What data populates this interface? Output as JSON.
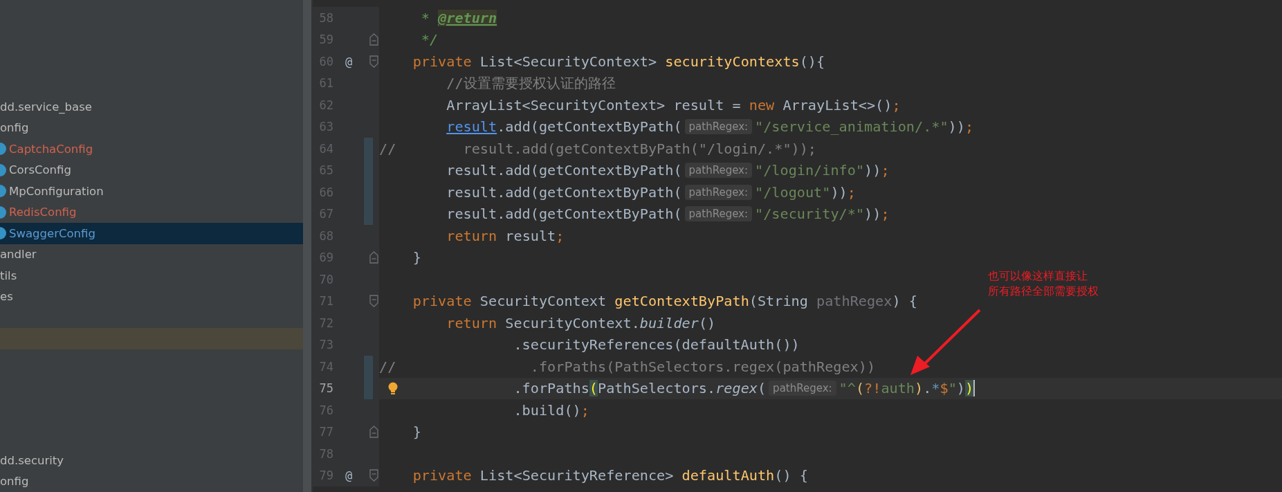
{
  "sidebar": {
    "sections": [
      {
        "items": [
          {
            "kind": "package",
            "label": "dd.service_base",
            "selected": false,
            "highlighted": false,
            "color": "#bbbbbb"
          },
          {
            "kind": "package",
            "label": "onfig",
            "selected": false,
            "highlighted": false,
            "color": "#bbbbbb"
          },
          {
            "kind": "class",
            "label": "CaptchaConfig",
            "selected": false,
            "highlighted": false,
            "color": "#d0624f"
          },
          {
            "kind": "class",
            "label": "CorsConfig",
            "selected": false,
            "highlighted": false,
            "color": "#bbbbbb"
          },
          {
            "kind": "class",
            "label": "MpConfiguration",
            "selected": false,
            "highlighted": false,
            "color": "#bbbbbb"
          },
          {
            "kind": "class",
            "label": "RedisConfig",
            "selected": false,
            "highlighted": false,
            "color": "#d0624f"
          },
          {
            "kind": "class",
            "label": "SwaggerConfig",
            "selected": true,
            "highlighted": false,
            "color": "#5a9bd3"
          },
          {
            "kind": "package",
            "label": "andler",
            "selected": false,
            "highlighted": false,
            "color": "#bbbbbb"
          },
          {
            "kind": "package",
            "label": "tils",
            "selected": false,
            "highlighted": false,
            "color": "#bbbbbb"
          },
          {
            "kind": "package",
            "label": "es",
            "selected": false,
            "highlighted": false,
            "color": "#bbbbbb"
          },
          {
            "kind": "blank",
            "selected": false,
            "highlighted": true
          }
        ]
      },
      {
        "items": [
          {
            "kind": "package",
            "label": "dd.security",
            "selected": false,
            "highlighted": false,
            "color": "#bbbbbb"
          },
          {
            "kind": "package",
            "label": "onfig",
            "selected": false,
            "highlighted": false,
            "color": "#bbbbbb"
          }
        ]
      }
    ]
  },
  "editor": {
    "lines": [
      {
        "number": "58",
        "tokens": [
          {
            "text": "     * ",
            "kind": "doc"
          },
          {
            "text": "@return",
            "kind": "doctag"
          }
        ]
      },
      {
        "number": "59",
        "fold_close": true,
        "tokens": [
          {
            "text": "     */",
            "kind": "doc"
          }
        ]
      },
      {
        "number": "60",
        "marker": "@",
        "fold_open": true,
        "tokens": [
          {
            "text": "    private",
            "kind": "keyword"
          },
          {
            "text": " List<SecurityContext> ",
            "kind": "plain"
          },
          {
            "text": "securityContexts",
            "kind": "method"
          },
          {
            "text": "(){",
            "kind": "plain"
          }
        ]
      },
      {
        "number": "61",
        "tokens": [
          {
            "text": "        //设置需要授权认证的路径",
            "kind": "comment"
          }
        ]
      },
      {
        "number": "62",
        "tokens": [
          {
            "text": "        ArrayList<SecurityContext> result = ",
            "kind": "plain"
          },
          {
            "text": "new",
            "kind": "keyword"
          },
          {
            "text": " ArrayList<>()",
            "kind": "plain"
          },
          {
            "text": ";",
            "kind": "keyword"
          }
        ]
      },
      {
        "number": "63",
        "tokens": [
          {
            "text": "        result",
            "kind": "link"
          },
          {
            "text": ".add(getContextByPath(",
            "kind": "plain"
          },
          {
            "text": "pathRegex:",
            "kind": "hint"
          },
          {
            "text": "\"/service_animation/.*\"",
            "kind": "string"
          },
          {
            "text": "))",
            "kind": "plain"
          },
          {
            "text": ";",
            "kind": "keyword"
          }
        ]
      },
      {
        "number": "64",
        "changed": true,
        "tokens": [
          {
            "text": "//        result.add(getContextByPath(\"/login/.*\"));",
            "kind": "comment"
          }
        ]
      },
      {
        "number": "65",
        "changed": true,
        "tokens": [
          {
            "text": "        result.add(getContextByPath(",
            "kind": "plain"
          },
          {
            "text": "pathRegex:",
            "kind": "hint"
          },
          {
            "text": "\"/login/info\"",
            "kind": "string"
          },
          {
            "text": "))",
            "kind": "plain"
          },
          {
            "text": ";",
            "kind": "keyword"
          }
        ]
      },
      {
        "number": "66",
        "changed": true,
        "tokens": [
          {
            "text": "        result.add(getContextByPath(",
            "kind": "plain"
          },
          {
            "text": "pathRegex:",
            "kind": "hint"
          },
          {
            "text": "\"/logout\"",
            "kind": "string"
          },
          {
            "text": "))",
            "kind": "plain"
          },
          {
            "text": ";",
            "kind": "keyword"
          }
        ]
      },
      {
        "number": "67",
        "changed": true,
        "tokens": [
          {
            "text": "        result.add(getContextByPath(",
            "kind": "plain"
          },
          {
            "text": "pathRegex:",
            "kind": "hint"
          },
          {
            "text": "\"/security/*\"",
            "kind": "string"
          },
          {
            "text": "))",
            "kind": "plain"
          },
          {
            "text": ";",
            "kind": "keyword"
          }
        ]
      },
      {
        "number": "68",
        "tokens": [
          {
            "text": "        return",
            "kind": "keyword"
          },
          {
            "text": " result",
            "kind": "plain"
          },
          {
            "text": ";",
            "kind": "keyword"
          }
        ]
      },
      {
        "number": "69",
        "fold_close": true,
        "tokens": [
          {
            "text": "    }",
            "kind": "plain"
          }
        ]
      },
      {
        "number": "70"
      },
      {
        "number": "71",
        "fold_open": true,
        "tokens": [
          {
            "text": "    private",
            "kind": "keyword"
          },
          {
            "text": " SecurityContext ",
            "kind": "plain"
          },
          {
            "text": "getContextByPath",
            "kind": "method"
          },
          {
            "text": "(String ",
            "kind": "plain"
          },
          {
            "text": "pathRegex",
            "kind": "unused"
          },
          {
            "text": ") {",
            "kind": "plain"
          }
        ]
      },
      {
        "number": "72",
        "tokens": [
          {
            "text": "        return",
            "kind": "keyword"
          },
          {
            "text": " SecurityContext.",
            "kind": "plain"
          },
          {
            "text": "builder",
            "kind": "italic"
          },
          {
            "text": "()",
            "kind": "plain"
          }
        ]
      },
      {
        "number": "73",
        "tokens": [
          {
            "text": "                .securityReferences(defaultAuth())",
            "kind": "plain"
          }
        ]
      },
      {
        "number": "74",
        "changed": true,
        "tokens": [
          {
            "text": "//                .forPaths(PathSelectors.regex(pathRegex))",
            "kind": "comment"
          }
        ]
      },
      {
        "number": "75",
        "changed": true,
        "current": true,
        "intention": true,
        "caret": true,
        "tokens": [
          {
            "text": "                .forPaths",
            "kind": "plain"
          },
          {
            "text": "(",
            "kind": "match"
          },
          {
            "text": "PathSelectors.",
            "kind": "plain"
          },
          {
            "text": "regex",
            "kind": "italic"
          },
          {
            "text": "(",
            "kind": "plain"
          },
          {
            "text": "pathRegex:",
            "kind": "hint"
          },
          {
            "text": "\"^",
            "kind": "string"
          },
          {
            "text": "(",
            "kind": "group"
          },
          {
            "text": "?!",
            "kind": "keyword"
          },
          {
            "text": "auth",
            "kind": "string"
          },
          {
            "text": ")",
            "kind": "group"
          },
          {
            "text": ".",
            "kind": "plain"
          },
          {
            "text": "*",
            "kind": "quant"
          },
          {
            "text": "$",
            "kind": "keyword"
          },
          {
            "text": "\"",
            "kind": "string"
          },
          {
            "text": ")",
            "kind": "plain"
          },
          {
            "text": ")",
            "kind": "match"
          }
        ]
      },
      {
        "number": "76",
        "tokens": [
          {
            "text": "                .build()",
            "kind": "plain"
          },
          {
            "text": ";",
            "kind": "keyword"
          }
        ]
      },
      {
        "number": "77",
        "fold_close": true,
        "tokens": [
          {
            "text": "    }",
            "kind": "plain"
          }
        ]
      },
      {
        "number": "78"
      },
      {
        "number": "79",
        "marker": "@",
        "fold_open": true,
        "tokens": [
          {
            "text": "    private",
            "kind": "keyword"
          },
          {
            "text": " List<SecurityReference> ",
            "kind": "plain"
          },
          {
            "text": "defaultAuth",
            "kind": "method"
          },
          {
            "text": "() {",
            "kind": "plain"
          }
        ]
      }
    ]
  },
  "annotation": {
    "lines": [
      "也可以像这样直接让",
      "所有路径全部需要授权"
    ]
  }
}
